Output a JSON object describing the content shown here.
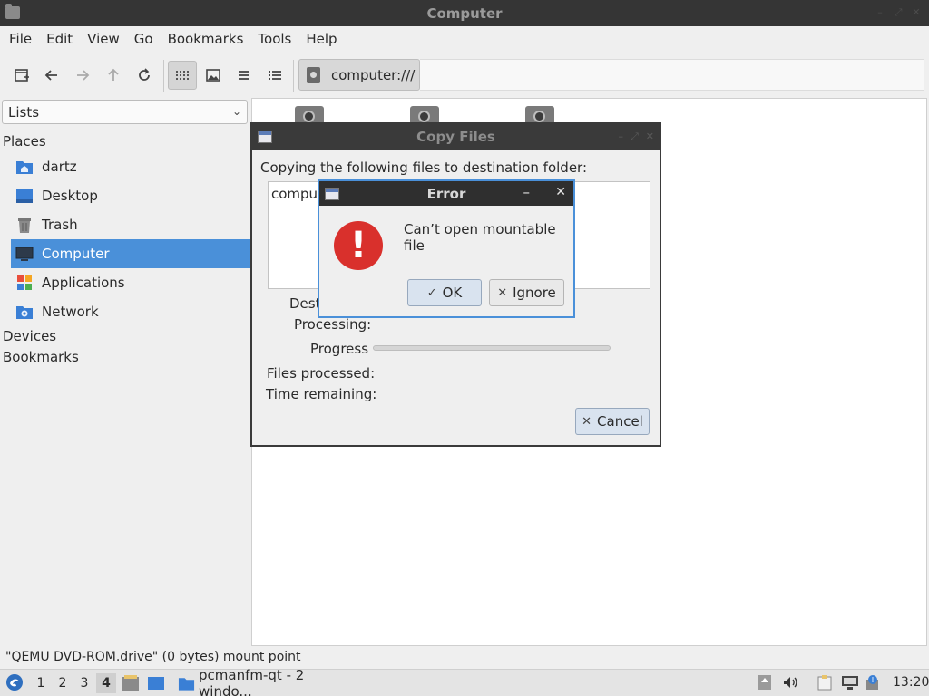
{
  "window": {
    "title": "Computer"
  },
  "menu": [
    "File",
    "Edit",
    "View",
    "Go",
    "Bookmarks",
    "Tools",
    "Help"
  ],
  "toolbar": {
    "path": "computer:///"
  },
  "sidebar": {
    "mode": "Lists",
    "places_heading": "Places",
    "places": [
      {
        "label": "dartz",
        "icon": "home-folder-icon"
      },
      {
        "label": "Desktop",
        "icon": "desktop-icon"
      },
      {
        "label": "Trash",
        "icon": "trash-icon"
      },
      {
        "label": "Computer",
        "icon": "computer-icon",
        "selected": true
      },
      {
        "label": "Applications",
        "icon": "applications-icon"
      },
      {
        "label": "Network",
        "icon": "network-icon"
      }
    ],
    "devices_heading": "Devices",
    "bookmarks_heading": "Bookmarks"
  },
  "status": {
    "text": "\"QEMU DVD-ROM.drive\" (0 bytes) mount point"
  },
  "copy_dialog": {
    "title": "Copy Files",
    "heading": "Copying the following files to destination folder:",
    "list_item": "comput",
    "dest_label": "Dest",
    "processing_label": "Processing:",
    "progress_label": "Progress",
    "progress_value": 0,
    "files_processed_label": "Files processed:",
    "time_remaining_label": "Time remaining:",
    "cancel_label": "Cancel"
  },
  "error_dialog": {
    "title": "Error",
    "message": "Can’t open mountable file",
    "ok_label": "OK",
    "ignore_label": "Ignore"
  },
  "taskbar": {
    "workspaces": [
      "1",
      "2",
      "3",
      "4"
    ],
    "current_workspace": "4",
    "task_label": "pcmanfm-qt - 2 windo...",
    "clock": "13:20"
  },
  "colors": {
    "accent": "#4a90d9",
    "error": "#d9302c",
    "titlebar": "#353535"
  }
}
